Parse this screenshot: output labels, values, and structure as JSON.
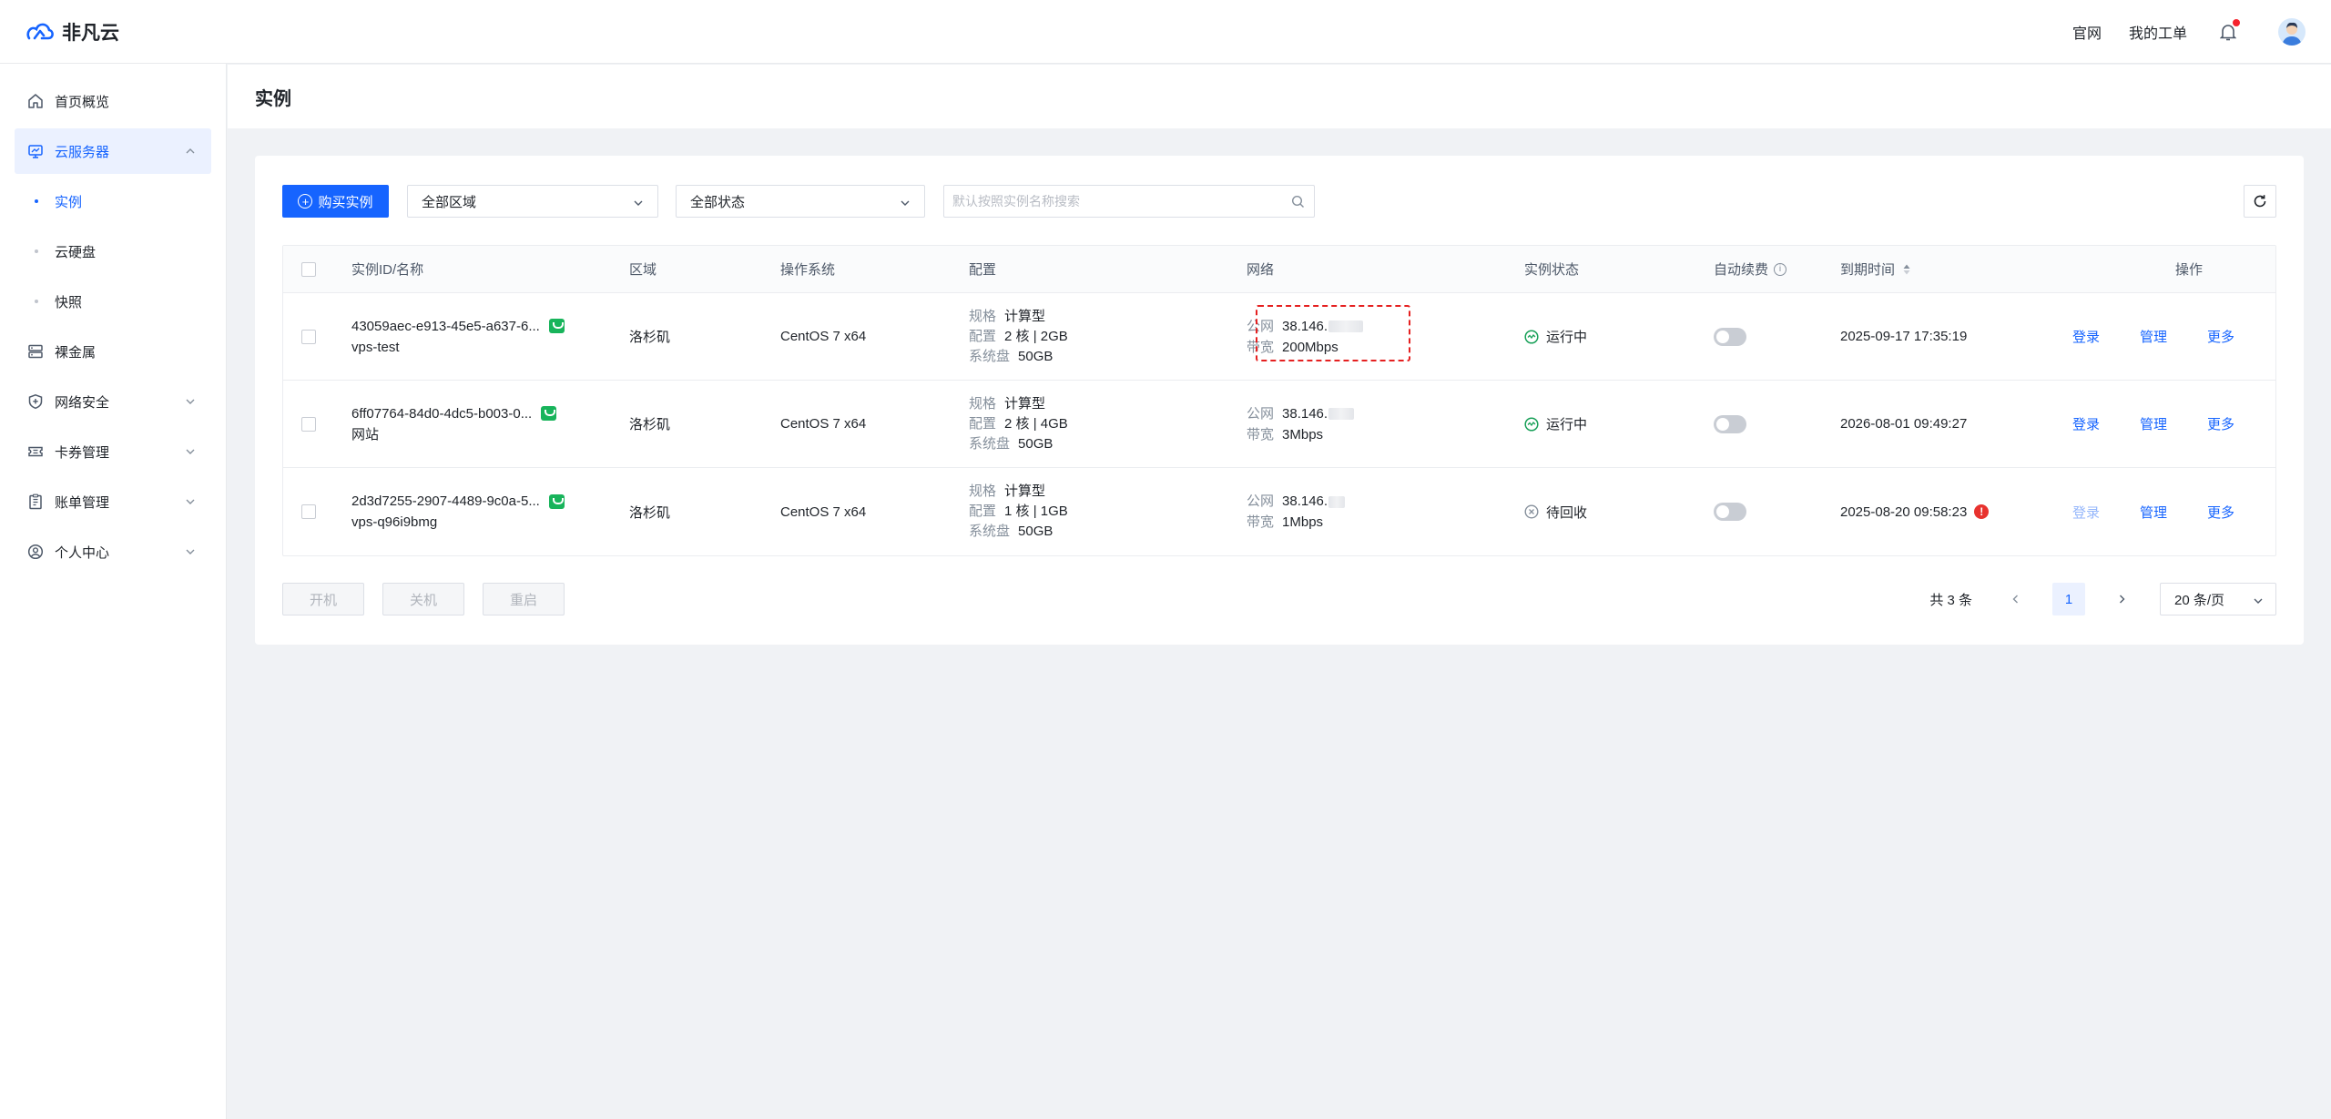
{
  "brand": {
    "name": "非凡云",
    "accent": "#1664ff"
  },
  "header": {
    "links": [
      "官网",
      "我的工单"
    ]
  },
  "sidebar": {
    "items": [
      {
        "label": "首页概览",
        "icon": "home-icon"
      },
      {
        "label": "云服务器",
        "icon": "cloud-server-icon",
        "expanded": true
      },
      {
        "label": "实例",
        "sub": true,
        "active": true
      },
      {
        "label": "云硬盘",
        "sub": true
      },
      {
        "label": "快照",
        "sub": true
      },
      {
        "label": "裸金属",
        "icon": "server-rack-icon"
      },
      {
        "label": "网络安全",
        "icon": "shield-icon"
      },
      {
        "label": "卡券管理",
        "icon": "ticket-icon"
      },
      {
        "label": "账单管理",
        "icon": "bill-icon"
      },
      {
        "label": "个人中心",
        "icon": "user-icon"
      }
    ]
  },
  "page": {
    "title": "实例"
  },
  "toolbar": {
    "buy_label": "购买实例",
    "region_select": "全部区域",
    "status_select": "全部状态",
    "search_placeholder": "默认按照实例名称搜索"
  },
  "table": {
    "columns": [
      "实例ID/名称",
      "区域",
      "操作系统",
      "配置",
      "网络",
      "实例状态",
      "自动续费",
      "到期时间",
      "操作"
    ],
    "rows": [
      {
        "id": "43059aec-e913-45e5-a637-6...",
        "name": "vps-test",
        "region": "洛杉矶",
        "os": "CentOS 7 x64",
        "spec_label": "规格",
        "spec": "计算型",
        "conf_label": "配置",
        "conf": "2 核 | 2GB",
        "disk_label": "系统盘",
        "disk": "50GB",
        "ip_label": "公网",
        "ip": "38.146.",
        "bw_label": "带宽",
        "bw": "200Mbps",
        "status": "运行中",
        "status_type": "running",
        "auto_renew": false,
        "expire": "2025-09-17 17:35:19",
        "ops": [
          "登录",
          "管理",
          "更多"
        ]
      },
      {
        "id": "6ff07764-84d0-4dc5-b003-0...",
        "name": "网站",
        "region": "洛杉矶",
        "os": "CentOS 7 x64",
        "spec_label": "规格",
        "spec": "计算型",
        "conf_label": "配置",
        "conf": "2 核 | 4GB",
        "disk_label": "系统盘",
        "disk": "50GB",
        "ip_label": "公网",
        "ip": "38.146.",
        "bw_label": "带宽",
        "bw": "3Mbps",
        "status": "运行中",
        "status_type": "running",
        "auto_renew": false,
        "expire": "2026-08-01 09:49:27",
        "ops": [
          "登录",
          "管理",
          "更多"
        ]
      },
      {
        "id": "2d3d7255-2907-4489-9c0a-5...",
        "name": "vps-q96i9bmg",
        "region": "洛杉矶",
        "os": "CentOS 7 x64",
        "spec_label": "规格",
        "spec": "计算型",
        "conf_label": "配置",
        "conf": "1 核 | 1GB",
        "disk_label": "系统盘",
        "disk": "50GB",
        "ip_label": "公网",
        "ip": "38.146.",
        "bw_label": "带宽",
        "bw": "1Mbps",
        "status": "待回收",
        "status_type": "pending",
        "auto_renew": false,
        "expire": "2025-08-20 09:58:23",
        "expire_warning": "!",
        "ops": [
          "登录",
          "管理",
          "更多"
        ]
      }
    ]
  },
  "bottom": {
    "actions": [
      "开机",
      "关机",
      "重启"
    ],
    "total": "共 3 条",
    "page": "1",
    "page_size": "20 条/页"
  }
}
